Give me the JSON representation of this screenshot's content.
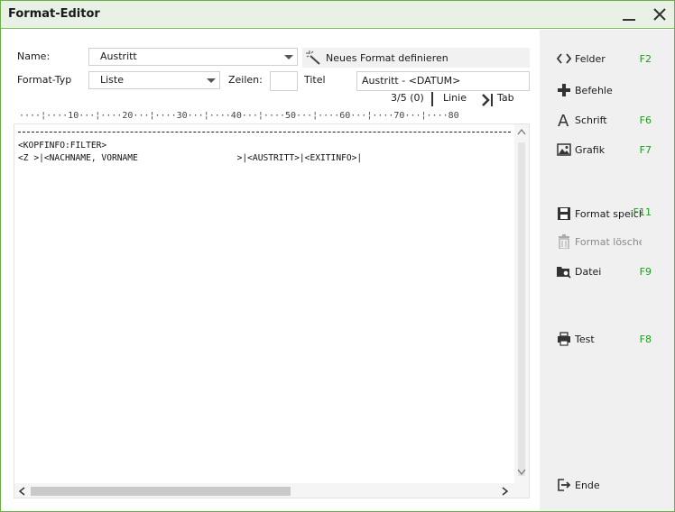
{
  "window": {
    "title": "Format-Editor"
  },
  "form": {
    "name_label": "Name:",
    "name_value": "Austritt",
    "type_label": "Format-Typ",
    "type_value": "Liste",
    "rows_label": "Zeilen:",
    "rows_value": "",
    "title_label": "Titel",
    "title_value": "Austritt - <DATUM>",
    "new_format_label": "Neues Format definieren"
  },
  "status": {
    "position": "3/5 (0)",
    "line_label": "Linie",
    "tab_label": "Tab"
  },
  "ruler": "····¦····10···¦····20···¦····30···¦····40···¦····50···¦····60···¦····70···¦····80",
  "editor": {
    "lines": [
      "<KOPFINFO:FILTER>",
      "<Z >|<NACHNAME, VORNAME                   >|<AUSTRITT>|<EXITINFO>|"
    ]
  },
  "sidebar": {
    "items": [
      {
        "label": "Felder",
        "key": "F2",
        "icon": "code-brackets-icon"
      },
      {
        "label": "Befehle",
        "key": "",
        "icon": "plus-icon"
      },
      {
        "label": "Schrift",
        "key": "F6",
        "icon": "font-a-icon"
      },
      {
        "label": "Grafik",
        "key": "F7",
        "icon": "image-icon"
      },
      {
        "label": "Format speichern",
        "key": "F11",
        "icon": "save-icon"
      },
      {
        "label": "Format löschen",
        "key": "",
        "icon": "trash-icon"
      },
      {
        "label": "Datei",
        "key": "F9",
        "icon": "folder-search-icon"
      },
      {
        "label": "Test",
        "key": "F8",
        "icon": "printer-icon"
      },
      {
        "label": "Ende",
        "key": "",
        "icon": "exit-icon"
      }
    ]
  },
  "colors": {
    "accent": "#6bb046",
    "shortcut": "#1e9e1e",
    "sidebar_bg": "#f0f0f0"
  }
}
